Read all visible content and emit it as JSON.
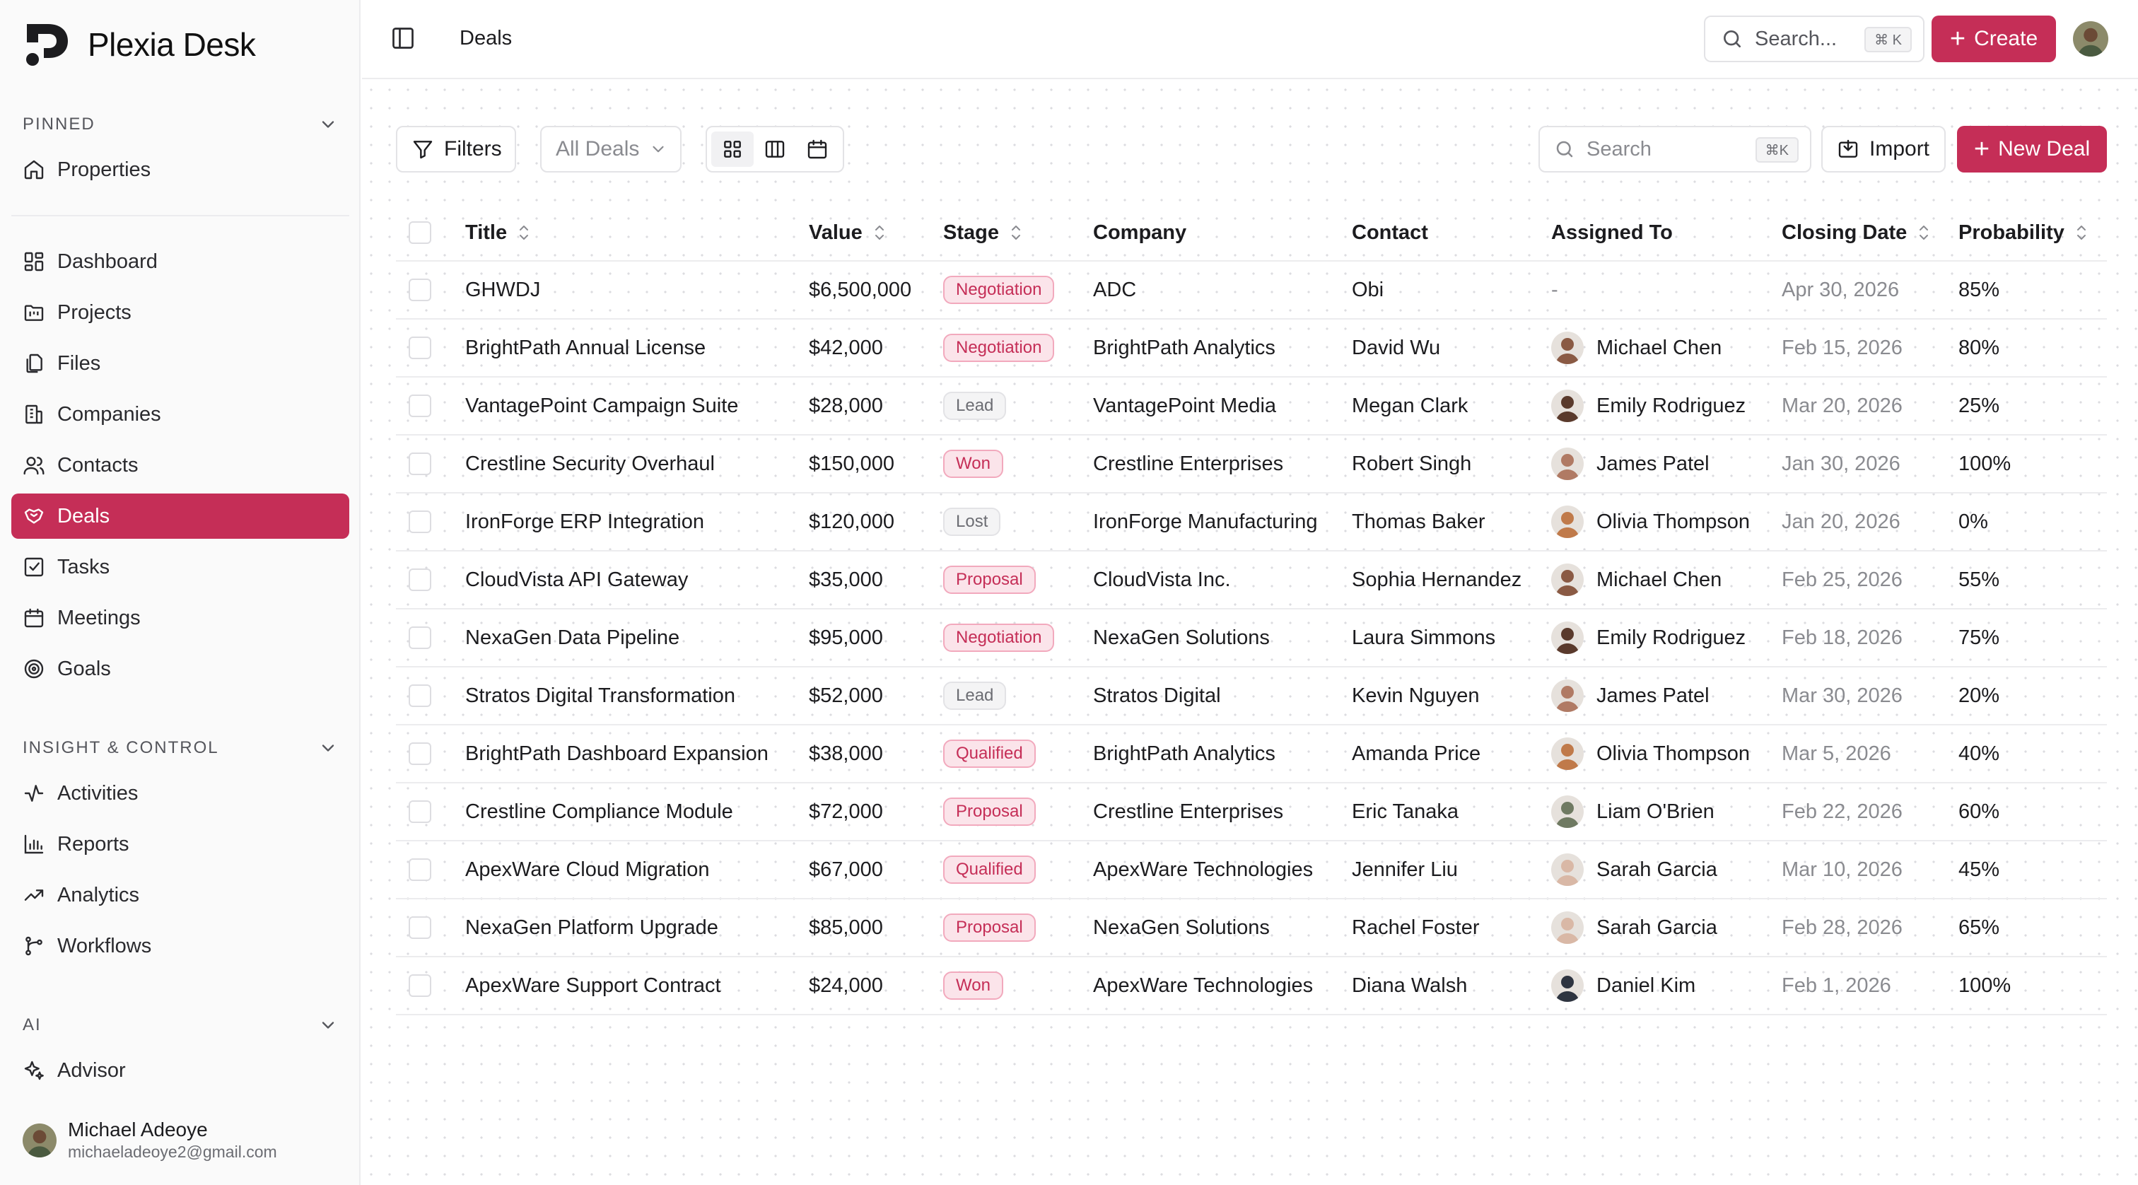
{
  "app": {
    "name": "Plexia Desk"
  },
  "sidebar": {
    "pinned_label": "PINNED",
    "pinned_items": [
      {
        "label": "Properties",
        "icon": "home-icon"
      }
    ],
    "main_items": [
      {
        "label": "Dashboard",
        "icon": "dashboard-icon"
      },
      {
        "label": "Projects",
        "icon": "folder-kanban-icon"
      },
      {
        "label": "Files",
        "icon": "files-icon"
      },
      {
        "label": "Companies",
        "icon": "building-icon"
      },
      {
        "label": "Contacts",
        "icon": "users-icon"
      },
      {
        "label": "Deals",
        "icon": "handshake-icon",
        "active": true
      },
      {
        "label": "Tasks",
        "icon": "checkbox-icon"
      },
      {
        "label": "Meetings",
        "icon": "calendar-icon"
      },
      {
        "label": "Goals",
        "icon": "target-icon"
      }
    ],
    "insight_label": "INSIGHT & CONTROL",
    "insight_items": [
      {
        "label": "Activities",
        "icon": "activity-icon"
      },
      {
        "label": "Reports",
        "icon": "bar-chart-icon"
      },
      {
        "label": "Analytics",
        "icon": "trending-up-icon"
      },
      {
        "label": "Workflows",
        "icon": "workflow-icon"
      }
    ],
    "ai_label": "AI",
    "ai_items": [
      {
        "label": "Advisor",
        "icon": "sparkles-icon"
      }
    ],
    "user": {
      "name": "Michael Adeoye",
      "email": "michaeladeoye2@gmail.com"
    }
  },
  "header": {
    "page": "Deals",
    "search_placeholder": "Search...",
    "search_shortcut": "⌘ K",
    "create_label": "Create"
  },
  "toolbar": {
    "filters_label": "Filters",
    "view_select": "All Deals",
    "search_placeholder": "Search",
    "search_shortcut": "⌘K",
    "import_label": "Import",
    "new_deal_label": "New Deal"
  },
  "colors": {
    "accent": "#c52e57",
    "badge_pink_bg": "#fbe4ea",
    "badge_gray_bg": "#f4f4f5"
  },
  "table": {
    "columns": [
      "Title",
      "Value",
      "Stage",
      "Company",
      "Contact",
      "Assigned To",
      "Closing Date",
      "Probability"
    ],
    "rows": [
      {
        "title": "GHWDJ",
        "value": "$6,500,000",
        "stage": "Negotiation",
        "stage_tone": "pink",
        "company": "ADC",
        "contact": "Obi",
        "assigned": "-",
        "avatar": "",
        "closing": "Apr 30, 2026",
        "probability": "85%"
      },
      {
        "title": "BrightPath Annual License",
        "value": "$42,000",
        "stage": "Negotiation",
        "stage_tone": "pink",
        "company": "BrightPath Analytics",
        "contact": "David Wu",
        "assigned": "Michael Chen",
        "avatar": "#8a5a44",
        "closing": "Feb 15, 2026",
        "probability": "80%"
      },
      {
        "title": "VantagePoint Campaign Suite",
        "value": "$28,000",
        "stage": "Lead",
        "stage_tone": "gray",
        "company": "VantagePoint Media",
        "contact": "Megan Clark",
        "assigned": "Emily Rodriguez",
        "avatar": "#5a3a2c",
        "closing": "Mar 20, 2026",
        "probability": "25%"
      },
      {
        "title": "Crestline Security Overhaul",
        "value": "$150,000",
        "stage": "Won",
        "stage_tone": "pink",
        "company": "Crestline Enterprises",
        "contact": "Robert Singh",
        "assigned": "James Patel",
        "avatar": "#b07a64",
        "closing": "Jan 30, 2026",
        "probability": "100%"
      },
      {
        "title": "IronForge ERP Integration",
        "value": "$120,000",
        "stage": "Lost",
        "stage_tone": "gray",
        "company": "IronForge Manufacturing",
        "contact": "Thomas Baker",
        "assigned": "Olivia Thompson",
        "avatar": "#c07a4a",
        "closing": "Jan 20, 2026",
        "probability": "0%"
      },
      {
        "title": "CloudVista API Gateway",
        "value": "$35,000",
        "stage": "Proposal",
        "stage_tone": "pink",
        "company": "CloudVista Inc.",
        "contact": "Sophia Hernandez",
        "assigned": "Michael Chen",
        "avatar": "#8a5a44",
        "closing": "Feb 25, 2026",
        "probability": "55%"
      },
      {
        "title": "NexaGen Data Pipeline",
        "value": "$95,000",
        "stage": "Negotiation",
        "stage_tone": "pink",
        "company": "NexaGen Solutions",
        "contact": "Laura Simmons",
        "assigned": "Emily Rodriguez",
        "avatar": "#5a3a2c",
        "closing": "Feb 18, 2026",
        "probability": "75%"
      },
      {
        "title": "Stratos Digital Transformation",
        "value": "$52,000",
        "stage": "Lead",
        "stage_tone": "gray",
        "company": "Stratos Digital",
        "contact": "Kevin Nguyen",
        "assigned": "James Patel",
        "avatar": "#b07a64",
        "closing": "Mar 30, 2026",
        "probability": "20%"
      },
      {
        "title": "BrightPath Dashboard Expansion",
        "value": "$38,000",
        "stage": "Qualified",
        "stage_tone": "pink",
        "company": "BrightPath Analytics",
        "contact": "Amanda Price",
        "assigned": "Olivia Thompson",
        "avatar": "#c07a4a",
        "closing": "Mar 5, 2026",
        "probability": "40%"
      },
      {
        "title": "Crestline Compliance Module",
        "value": "$72,000",
        "stage": "Proposal",
        "stage_tone": "pink",
        "company": "Crestline Enterprises",
        "contact": "Eric Tanaka",
        "assigned": "Liam O'Brien",
        "avatar": "#6f7a62",
        "closing": "Feb 22, 2026",
        "probability": "60%"
      },
      {
        "title": "ApexWare Cloud Migration",
        "value": "$67,000",
        "stage": "Qualified",
        "stage_tone": "pink",
        "company": "ApexWare Technologies",
        "contact": "Jennifer Liu",
        "assigned": "Sarah Garcia",
        "avatar": "#d9b8a6",
        "closing": "Mar 10, 2026",
        "probability": "45%"
      },
      {
        "title": "NexaGen Platform Upgrade",
        "value": "$85,000",
        "stage": "Proposal",
        "stage_tone": "pink",
        "company": "NexaGen Solutions",
        "contact": "Rachel Foster",
        "assigned": "Sarah Garcia",
        "avatar": "#d9b8a6",
        "closing": "Feb 28, 2026",
        "probability": "65%"
      },
      {
        "title": "ApexWare Support Contract",
        "value": "$24,000",
        "stage": "Won",
        "stage_tone": "pink",
        "company": "ApexWare Technologies",
        "contact": "Diana Walsh",
        "assigned": "Daniel Kim",
        "avatar": "#2e3440",
        "closing": "Feb 1, 2026",
        "probability": "100%"
      }
    ]
  }
}
